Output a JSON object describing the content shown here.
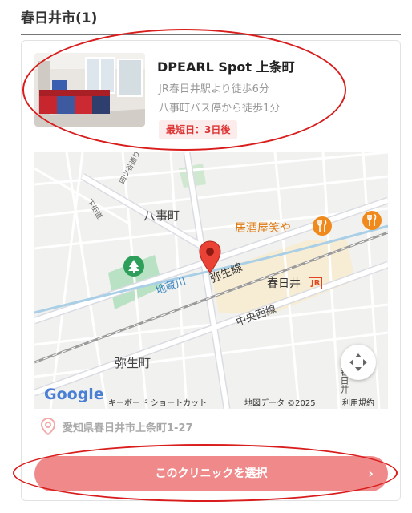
{
  "section": {
    "title": "春日井市(1)"
  },
  "clinic": {
    "name": "DPEARL Spot 上条町",
    "access_1": "JR春日井駅より徒歩6分",
    "access_2": "八事町バス停から徒歩1分",
    "earliest": "最短日：3日後",
    "address": "愛知県春日井市上条町1-27",
    "select_label": "このクリニックを選択",
    "select_chevron": "›"
  },
  "map": {
    "labels": {
      "yagoto_cho": "八事町",
      "izakaya": "居酒屋笑や",
      "yayoi_line": "弥生線",
      "kasugai": "春日井",
      "jr": "JR",
      "jizo_river": "地蔵川",
      "chuo_west_line": "中央西線",
      "yayoi_cho": "弥生町",
      "shimo_street": "下街道",
      "yotsuya_street": "四ツ谷通り",
      "vertical_right": "春日井"
    },
    "footer": {
      "google": "Google",
      "shortcuts": "キーボード ショートカット",
      "map_data": "地図データ ©2025",
      "terms": "利用規約"
    },
    "icons": [
      "map-pin-icon",
      "restaurant-icon",
      "park-icon",
      "expand-icon"
    ]
  },
  "colors": {
    "accent_red": "#d33333",
    "button_pink": "#f08a8a",
    "badge_bg": "#fdecec",
    "poi_orange": "#f08a1c",
    "park_green": "#2e9e5b",
    "highlight_red": "#d91c1c"
  }
}
